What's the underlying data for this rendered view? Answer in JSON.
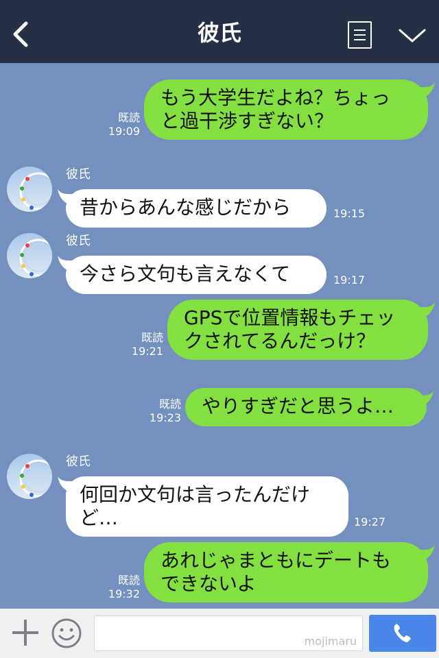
{
  "header": {
    "title": "彼氏"
  },
  "input": {
    "watermark": "mojimaru"
  },
  "messages": [
    {
      "side": "out",
      "line1": "もう大学生だよね？ちょっ",
      "line2": "と過干渉すぎない？",
      "read": "既読",
      "time": "19:09"
    },
    {
      "side": "in",
      "name": "彼氏",
      "line1": "昔からあんな感じだから",
      "line2": "",
      "time": "19:15"
    },
    {
      "side": "in",
      "name": "彼氏",
      "line1": "今さら文句も言えなくて",
      "line2": "",
      "time": "19:17"
    },
    {
      "side": "out",
      "line1": "GPSで位置情報もチェッ",
      "line2": "クされてるんだっけ？",
      "read": "既読",
      "time": "19:21"
    },
    {
      "side": "out",
      "line1": "やりすぎだと思うよ…",
      "line2": "",
      "read": "既読",
      "time": "19:23"
    },
    {
      "side": "in",
      "name": "彼氏",
      "line1": "何回か文句は言ったんだけ",
      "line2": "ど…",
      "time": "19:27"
    },
    {
      "side": "out",
      "line1": "あれじゃまともにデートも",
      "line2": "できないよ",
      "read": "既読",
      "time": "19:32"
    }
  ],
  "colors": {
    "header": "#263045",
    "background": "#7390bf",
    "outgoing": "#84e041",
    "incoming": "#ffffff",
    "send": "#4a86e8"
  },
  "icons": {
    "back": "chevron-left-icon",
    "menu": "note-icon",
    "collapse": "chevron-down-icon",
    "add": "plus-icon",
    "sticker": "smiley-icon",
    "call": "phone-icon"
  }
}
